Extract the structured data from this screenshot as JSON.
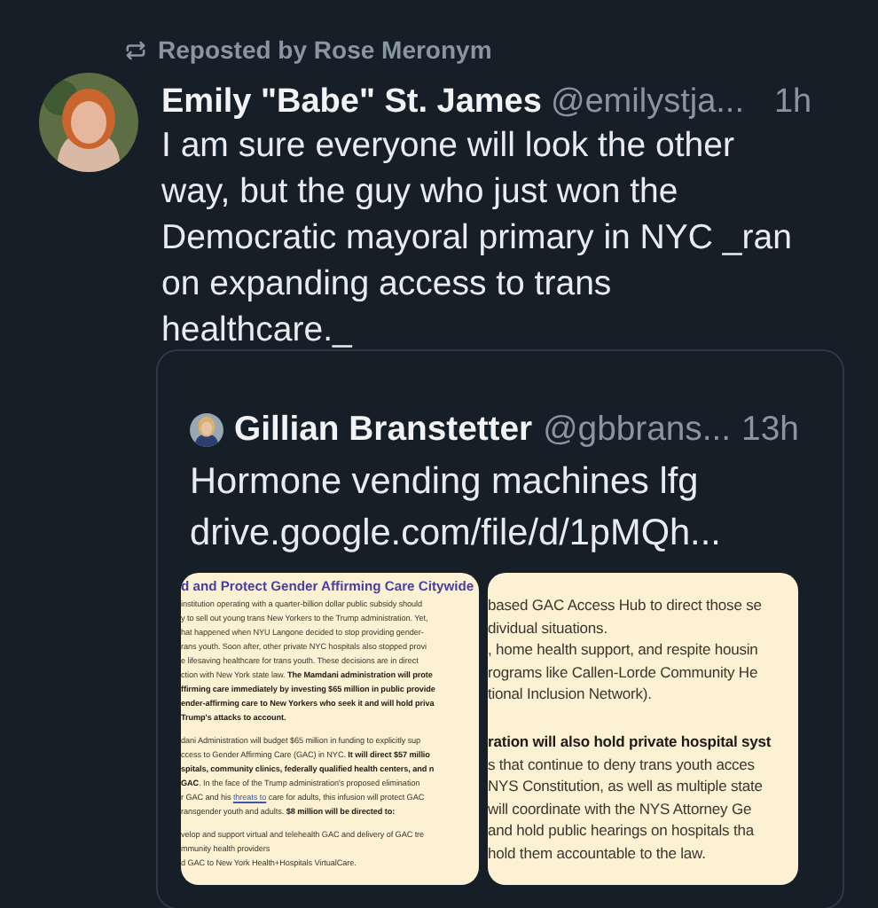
{
  "repost": {
    "label": "Reposted by Rose Meronym"
  },
  "post": {
    "author": "Emily \"Babe\" St. James",
    "handle": "@emilystja...",
    "time": "1h",
    "text": "I am sure everyone will look the other way, but the guy who just won the Democratic mayoral primary in NYC _ran on expanding access to trans healthcare._"
  },
  "quote": {
    "author": "Gillian Branstetter",
    "handle": "@gbbrans...",
    "time": "13h",
    "text": "Hormone vending machines lfg",
    "link": "drive.google.com/file/d/1pMQh...",
    "images": [
      {
        "kind": "document",
        "heading": "d and Protect Gender Affirming Care Citywide",
        "paragraphs": [
          {
            "lines": [
              {
                "text": "institution operating with a quarter-billion dollar public subsidy should"
              },
              {
                "text": "y to sell out young trans New Yorkers to the Trump administration. Yet,"
              },
              {
                "text": "hat happened when NYU Langone decided to stop providing gender-"
              },
              {
                "text": "rans youth. Soon after, other private NYC hospitals also stopped provi"
              },
              {
                "text": "e lifesaving healthcare for trans youth. These decisions are in direct"
              },
              {
                "text": "ction with New York state law. **The Mamdani administration will prote**"
              },
              {
                "text": "**ffirming care immediately by investing $65 million in public provide**"
              },
              {
                "text": "**ender-affirming care to New Yorkers who seek it and will hold priva**"
              },
              {
                "text": "**Trump's attacks to account.**"
              }
            ]
          },
          {
            "lines": [
              {
                "text": "dani Administration will budget $65 million in funding to explicitly sup"
              },
              {
                "text": "ccess to Gender Affirming Care (GAC) in NYC. **It will direct $57 millio**"
              },
              {
                "text": "**spitals, community clinics, federally qualified health centers, and n**"
              },
              {
                "text": "**GAC**. In the face of the Trump administration's proposed elimination"
              },
              {
                "text": "r GAC and his ",
                "link": "threats to",
                "after": " care for adults, this infusion will protect GAC"
              },
              {
                "text": "ransgender youth and adults. **$8 million will be directed to:**"
              }
            ]
          },
          {
            "lines": [
              {
                "text": "velop and support virtual and telehealth GAC and delivery of GAC tre"
              },
              {
                "text": "mmunity health providers"
              },
              {
                "text": "d GAC to New York Health+Hospitals VirtualCare."
              }
            ]
          }
        ]
      },
      {
        "kind": "document",
        "paragraphs": [
          {
            "lines": [
              {
                "text": "based GAC Access Hub to direct those se"
              },
              {
                "text": "dividual situations."
              },
              {
                "text": ", home health support, and respite housin"
              },
              {
                "text": "rograms like Callen-Lorde Community He"
              },
              {
                "text": "tional Inclusion Network)."
              }
            ]
          },
          {
            "lines": [
              {
                "text": "**ration will also hold private hospital syst**"
              },
              {
                "text": "s that continue to deny trans youth acces"
              },
              {
                "text": "NYS Constitution, as well as multiple state"
              },
              {
                "text": "will coordinate with the NYS Attorney Ge"
              },
              {
                "text": "and hold public hearings on hospitals tha"
              },
              {
                "text": "hold them accountable to the law."
              }
            ]
          }
        ]
      }
    ]
  }
}
